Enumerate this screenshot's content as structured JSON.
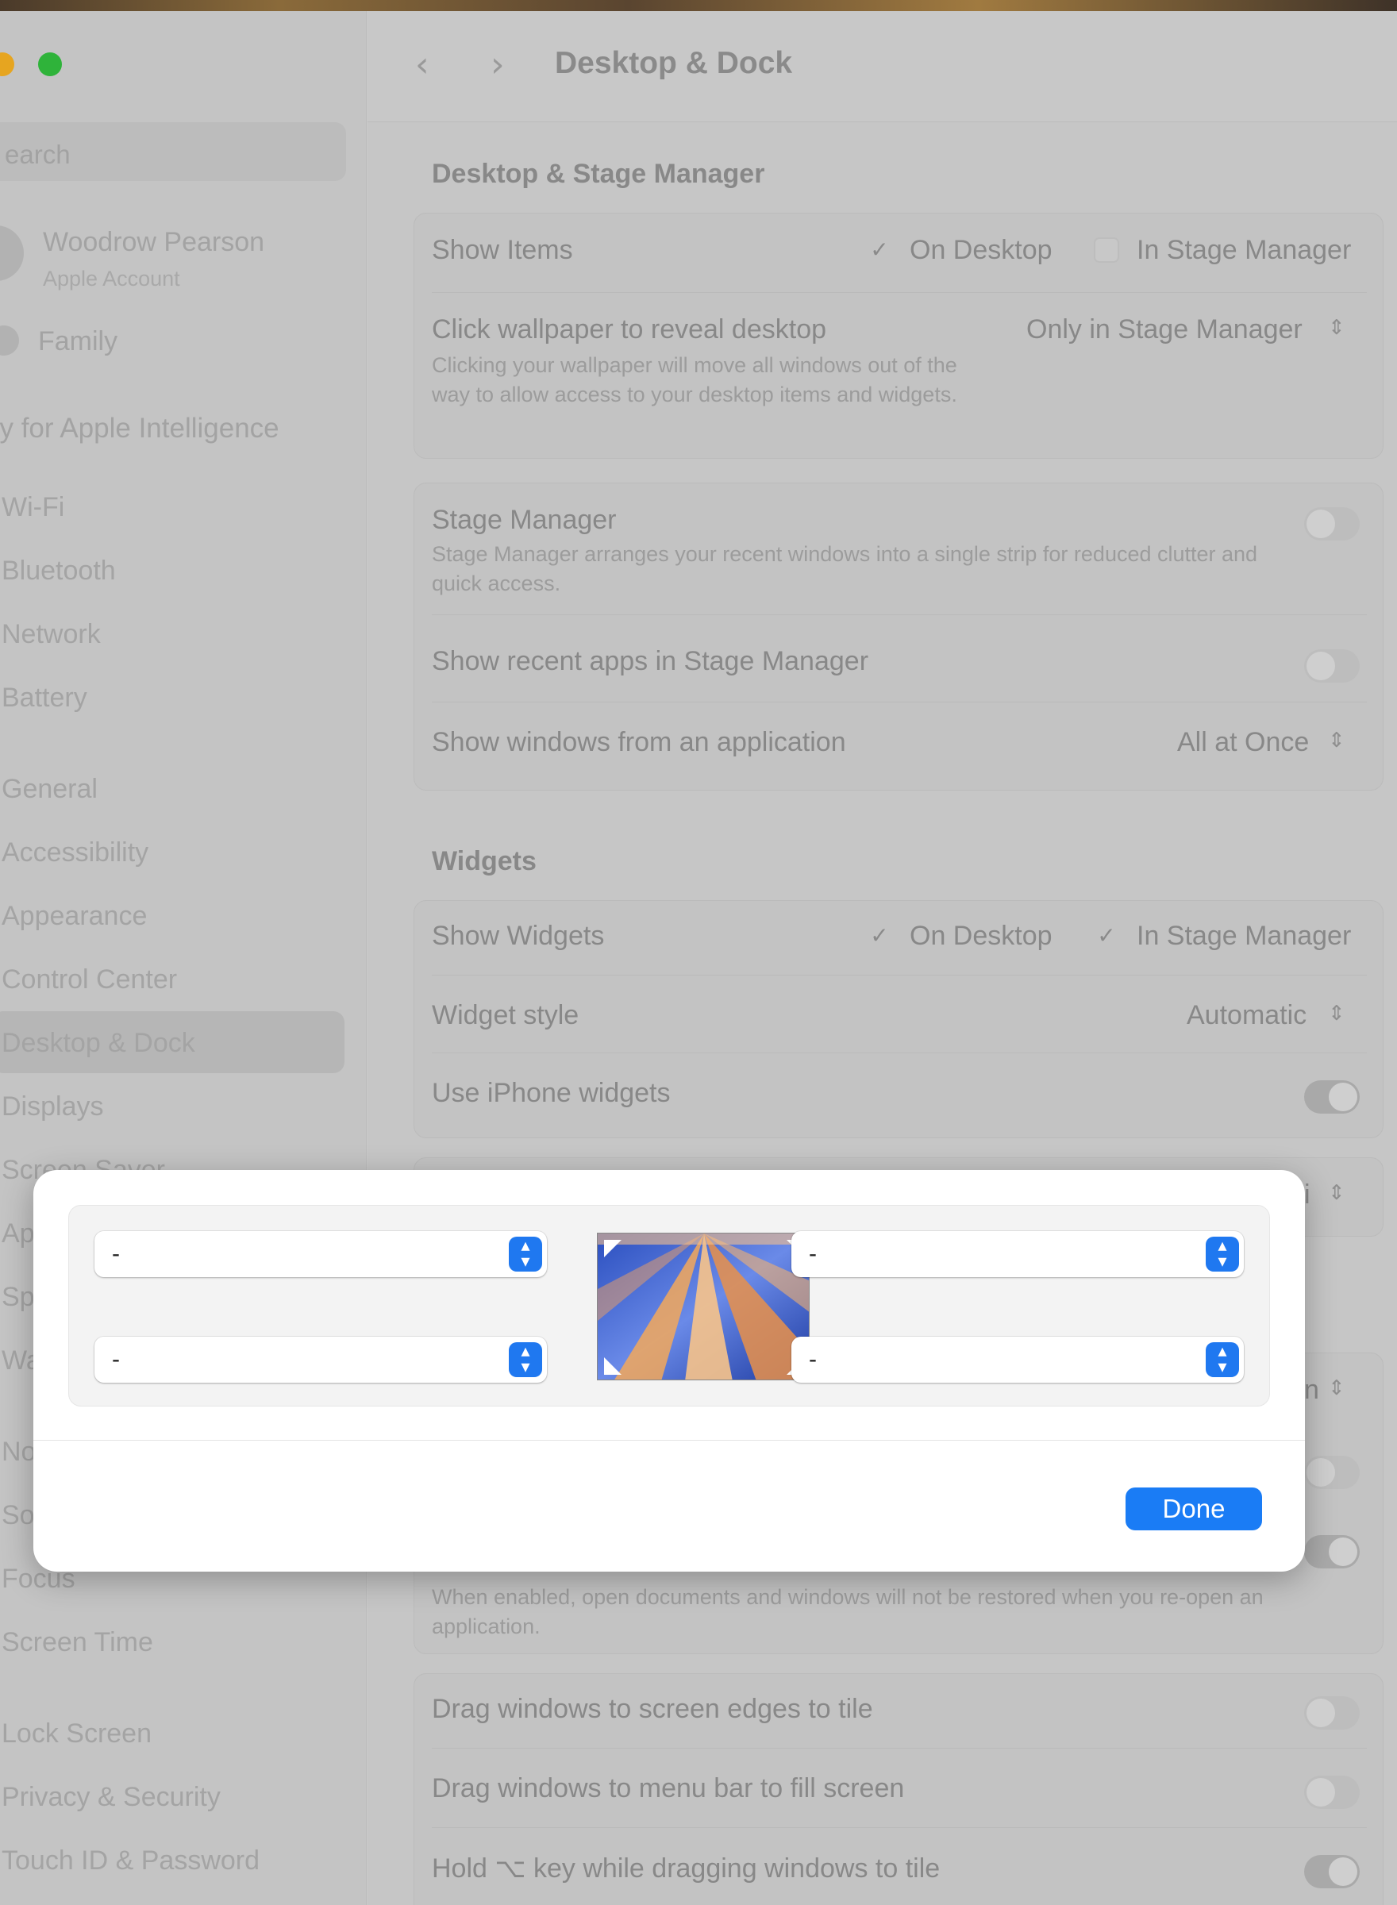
{
  "sidebar": {
    "search_placeholder": "earch",
    "account_name": "Woodrow Pearson",
    "account_sub": "Apple Account",
    "family": "Family",
    "apple_intelligence": "dy for Apple Intelligence",
    "items": {
      "wifi": "Wi-Fi",
      "bluetooth": "Bluetooth",
      "network": "Network",
      "battery": "Battery",
      "general": "General",
      "accessibility": "Accessibility",
      "appearance": "Appearance",
      "control_center": "Control Center",
      "desktop_dock": "Desktop & Dock",
      "displays": "Displays",
      "screen_saver": "Screen Saver",
      "ap": "Ap",
      "sp": "Sp",
      "wa": "Wa",
      "no": "No",
      "so": "So",
      "focus": "Focus",
      "screen_time": "Screen Time",
      "lock_screen": "Lock Screen",
      "privacy_security": "Privacy & Security",
      "touch_id": "Touch ID & Password"
    }
  },
  "header": {
    "back_icon": "‹",
    "forward_icon": "›",
    "title": "Desktop & Dock"
  },
  "desktop_stage": {
    "section_title": "Desktop & Stage Manager",
    "show_items_label": "Show Items",
    "on_desktop": "On Desktop",
    "in_stage_manager": "In Stage Manager",
    "on_desktop_checked": true,
    "in_stage_manager_checked": false,
    "click_wallpaper_label": "Click wallpaper to reveal desktop",
    "click_wallpaper_desc": "Clicking your wallpaper will move all windows out of the way to allow access to your desktop items and widgets.",
    "click_wallpaper_value": "Only in Stage Manager",
    "stage_manager_label": "Stage Manager",
    "stage_manager_desc": "Stage Manager arranges your recent windows into a single strip for reduced clutter and quick access.",
    "stage_manager_on": false,
    "show_recent_apps_label": "Show recent apps in Stage Manager",
    "show_recent_apps_on": false,
    "show_windows_label": "Show windows from an application",
    "show_windows_value": "All at Once"
  },
  "widgets": {
    "section_title": "Widgets",
    "show_widgets_label": "Show Widgets",
    "on_desktop": "On Desktop",
    "in_stage_manager": "In Stage Manager",
    "on_desktop_checked": true,
    "in_stage_manager_checked": true,
    "widget_style_label": "Widget style",
    "widget_style_value": "Automatic",
    "use_iphone_label": "Use iPhone widgets",
    "use_iphone_on": true,
    "partial_value_1": "i",
    "partial_value_2": "n"
  },
  "windows": {
    "restore_desc": "When enabled, open documents and windows will not be restored when you re-open an application.",
    "drag_edges_label": "Drag windows to screen edges to tile",
    "drag_edges_on": false,
    "drag_menubar_label": "Drag windows to menu bar to fill screen",
    "drag_menubar_on": false,
    "hold_key_label": "Hold ⌥ key while dragging windows to tile",
    "hold_key_on": true
  },
  "hot_corners_dialog": {
    "top_left_value": "-",
    "top_right_value": "-",
    "bottom_left_value": "-",
    "bottom_right_value": "-",
    "stepper_glyph": "⌃⌄",
    "done_label": "Done"
  },
  "colors": {
    "accent": "#1a7cf5",
    "traffic_yellow": "#e6a520",
    "traffic_green": "#2fb33a"
  }
}
